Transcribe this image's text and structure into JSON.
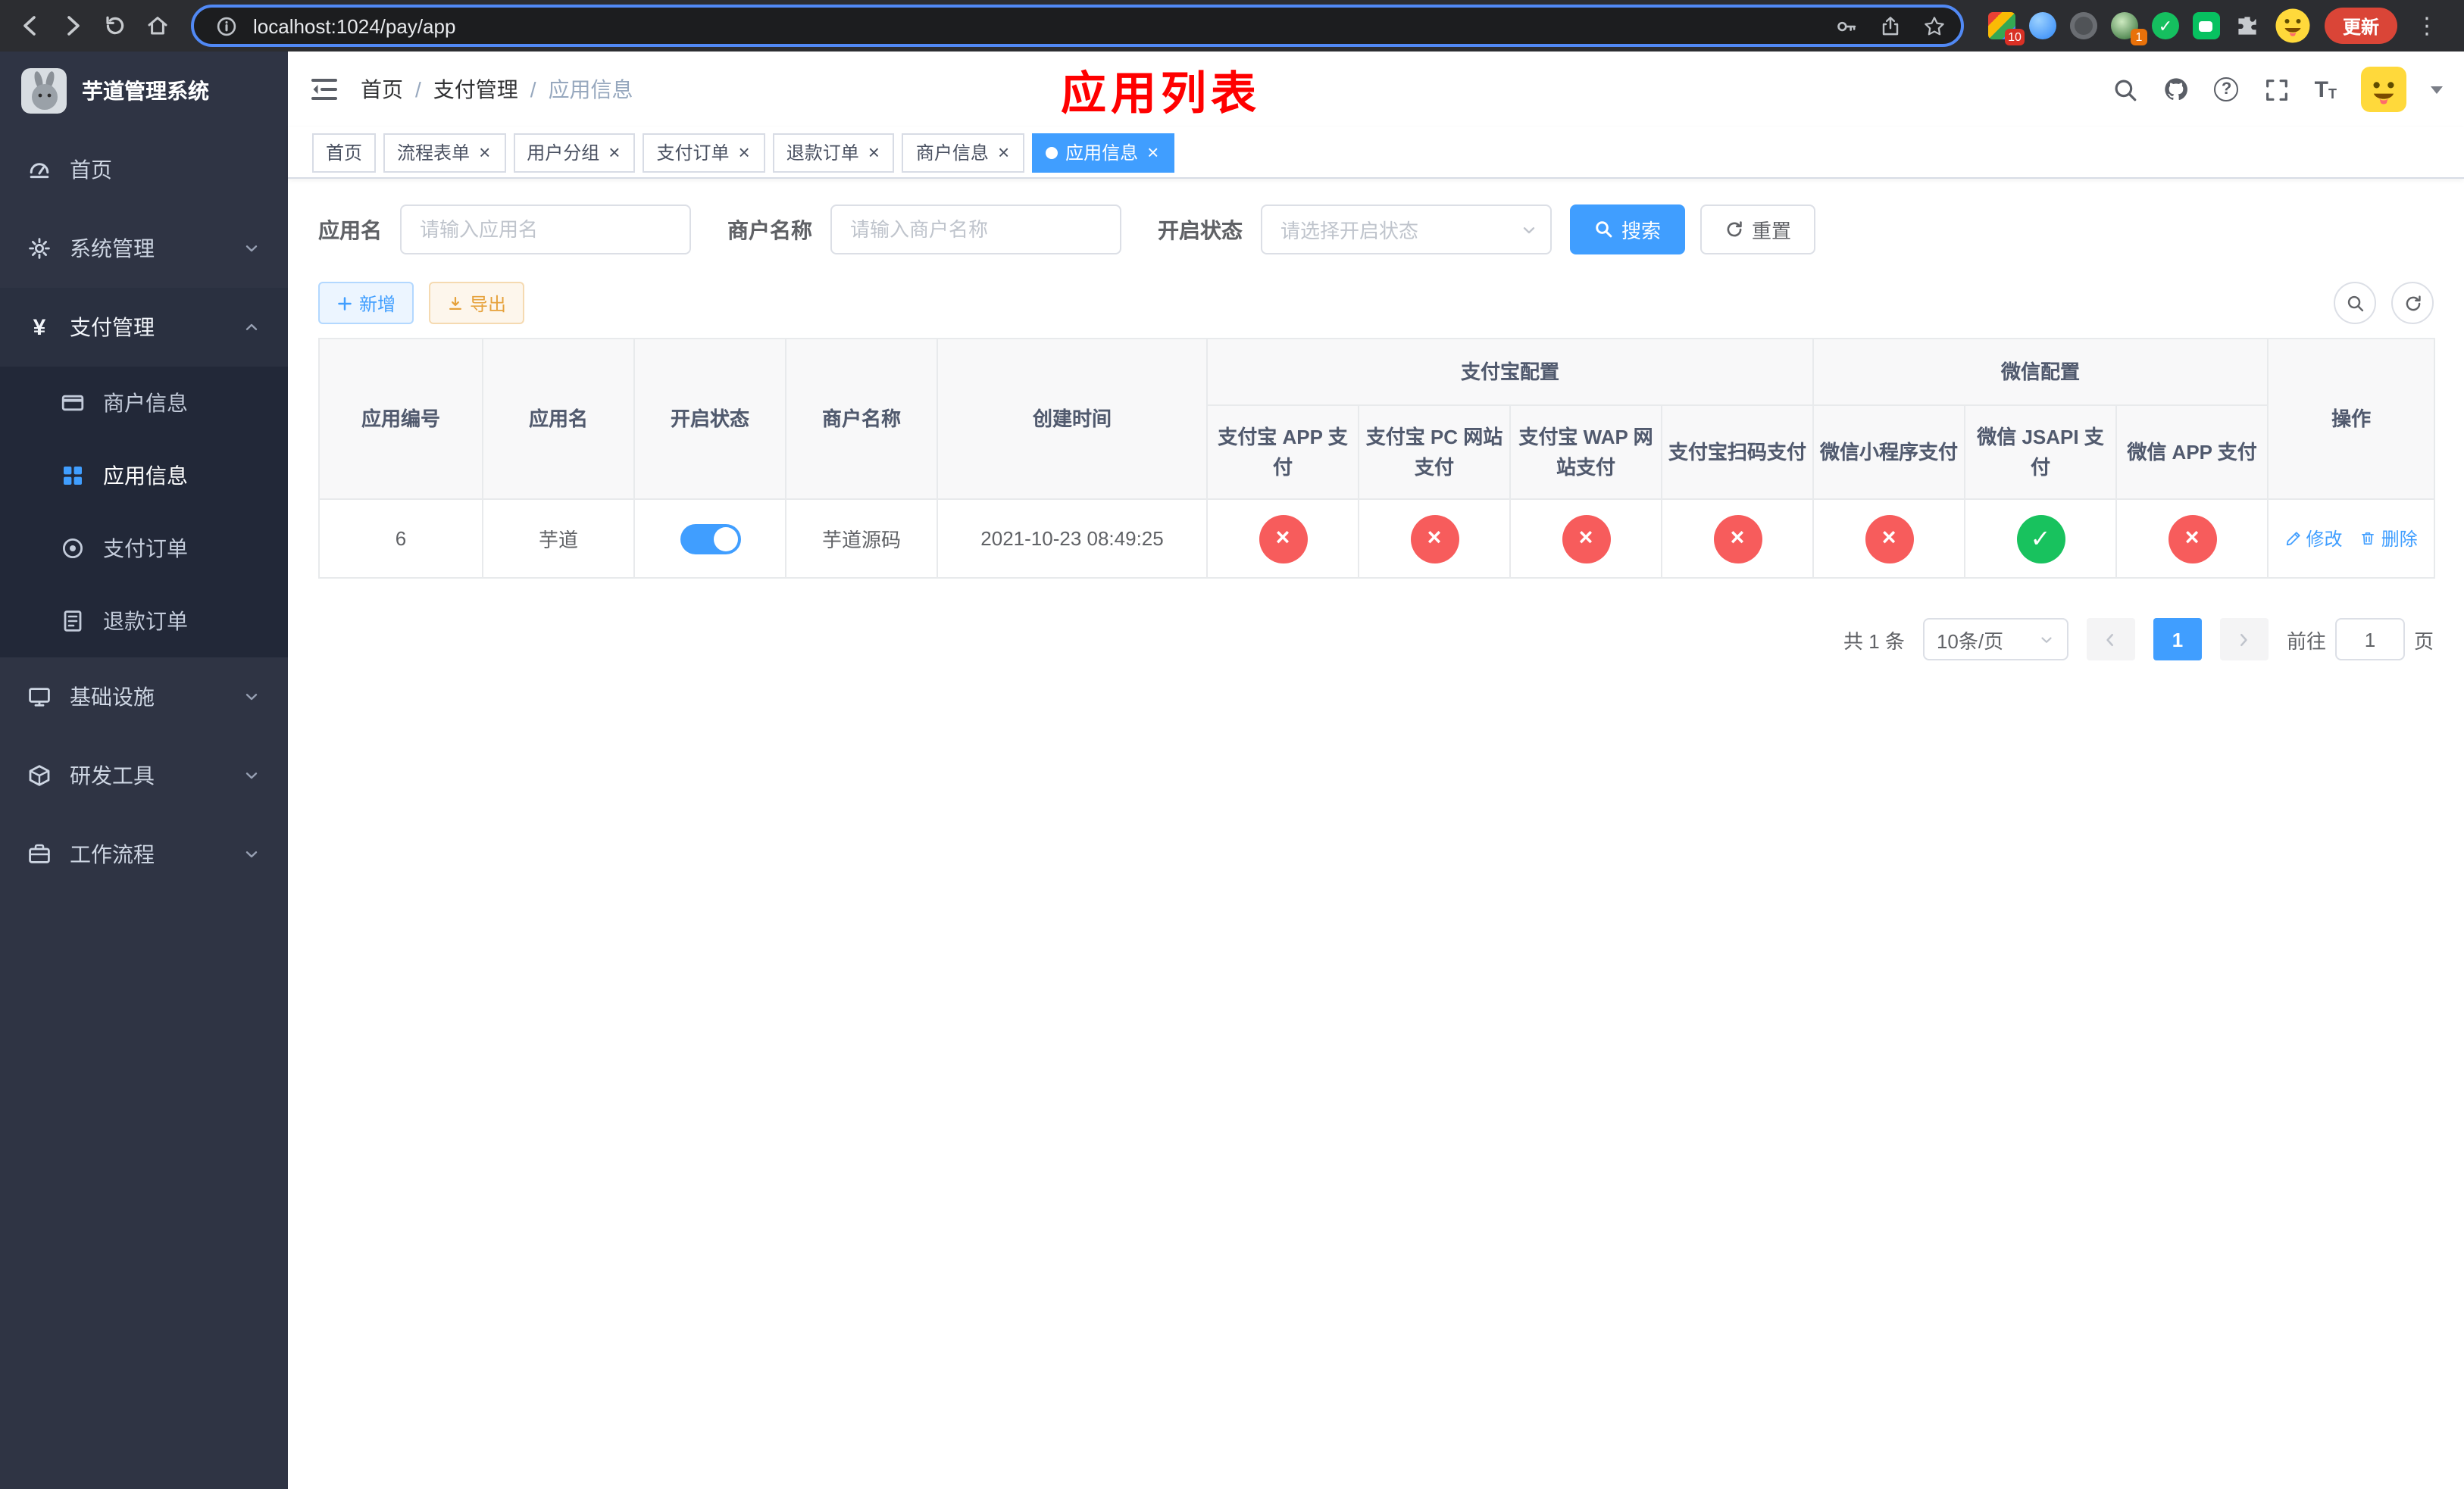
{
  "browser": {
    "url": "localhost:1024/pay/app",
    "update_label": "更新",
    "extensions_badge": "10",
    "avatar_badge": "1"
  },
  "sidebar": {
    "title": "芋道管理系统",
    "items": [
      {
        "label": "首页"
      },
      {
        "label": "系统管理"
      },
      {
        "label": "支付管理"
      },
      {
        "label": "商户信息"
      },
      {
        "label": "应用信息"
      },
      {
        "label": "支付订单"
      },
      {
        "label": "退款订单"
      },
      {
        "label": "基础设施"
      },
      {
        "label": "研发工具"
      },
      {
        "label": "工作流程"
      }
    ]
  },
  "header": {
    "breadcrumb": [
      "首页",
      "支付管理",
      "应用信息"
    ],
    "title": "应用列表"
  },
  "tabs": [
    {
      "label": "首页"
    },
    {
      "label": "流程表单"
    },
    {
      "label": "用户分组"
    },
    {
      "label": "支付订单"
    },
    {
      "label": "退款订单"
    },
    {
      "label": "商户信息"
    },
    {
      "label": "应用信息"
    }
  ],
  "filters": {
    "app_name_label": "应用名",
    "app_name_placeholder": "请输入应用名",
    "merchant_label": "商户名称",
    "merchant_placeholder": "请输入商户名称",
    "status_label": "开启状态",
    "status_placeholder": "请选择开启状态",
    "search_label": "搜索",
    "reset_label": "重置"
  },
  "toolbar": {
    "add_label": "新增",
    "export_label": "导出"
  },
  "table": {
    "group_alipay": "支付宝配置",
    "group_wechat": "微信配置",
    "col_id": "应用编号",
    "col_name": "应用名",
    "col_status": "开启状态",
    "col_merchant": "商户名称",
    "col_time": "创建时间",
    "col_alipay_app": "支付宝 APP 支付",
    "col_alipay_pc": "支付宝 PC 网站支付",
    "col_alipay_wap": "支付宝 WAP 网站支付",
    "col_alipay_qr": "支付宝扫码支付",
    "col_wx_lite": "微信小程序支付",
    "col_wx_jsapi": "微信 JSAPI 支付",
    "col_wx_app": "微信 APP 支付",
    "col_ops": "操作",
    "row": {
      "id": "6",
      "name": "芋道",
      "merchant": "芋道源码",
      "time": "2021-10-23 08:49:25",
      "edit_label": "修改",
      "delete_label": "删除"
    }
  },
  "pagination": {
    "total": "共 1 条",
    "page_size": "10条/页",
    "page": "1",
    "goto_label": "前往",
    "goto_value": "1",
    "goto_unit": "页"
  },
  "icons": {
    "close": "×",
    "check": "✓",
    "cross": "×",
    "question": "?",
    "yen": "¥",
    "dots": "⋮"
  },
  "colors": {
    "accent": "#409EFF",
    "success": "#18c25e",
    "danger": "#f75c5c",
    "title_red": "#ff0000",
    "sidebar_bg": "#2f3444",
    "submenu_bg": "#222838"
  }
}
